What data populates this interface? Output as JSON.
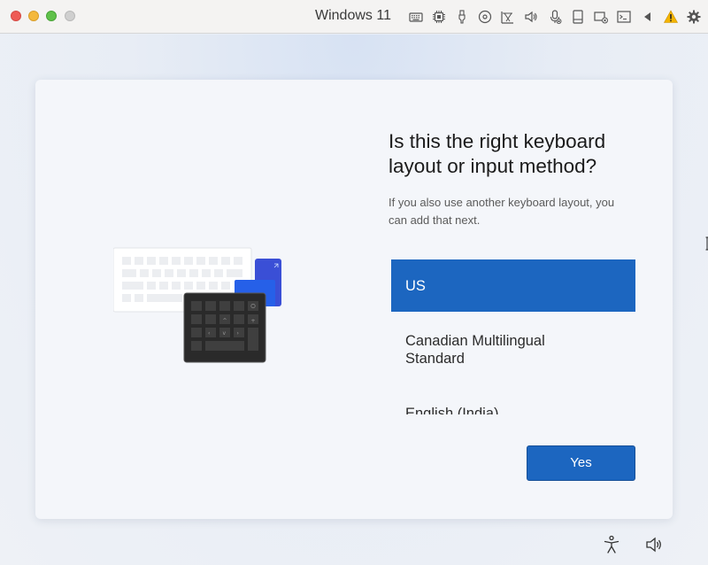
{
  "window": {
    "title": "Windows 11",
    "toolbar_icons": [
      "keyboard-icon",
      "cpu-icon",
      "usb-icon",
      "disc-icon",
      "network-icon",
      "speaker-icon",
      "microphone-icon",
      "storage-icon",
      "display-icon",
      "terminal-icon",
      "back-triangle-icon",
      "warning-icon",
      "settings-gear-icon"
    ]
  },
  "setup": {
    "title_line1": "Is this the right keyboard",
    "title_line2": "layout or input method?",
    "subtitle_line1": "If you also use another keyboard layout, you",
    "subtitle_line2": "can add that next.",
    "layouts": [
      {
        "label_line1": "US",
        "label_line2": "",
        "selected": true
      },
      {
        "label_line1": "Canadian Multilingual",
        "label_line2": "Standard",
        "selected": false
      },
      {
        "label_line1": "English (India)",
        "label_line2": "",
        "selected": false
      }
    ],
    "yes_button": "Yes"
  },
  "taskbar": {
    "icons": [
      "accessibility-icon",
      "volume-icon"
    ]
  },
  "colors": {
    "accent": "#1c66c0",
    "card_background": "#f4f6fa",
    "titlebar": "#f4f3f2"
  }
}
